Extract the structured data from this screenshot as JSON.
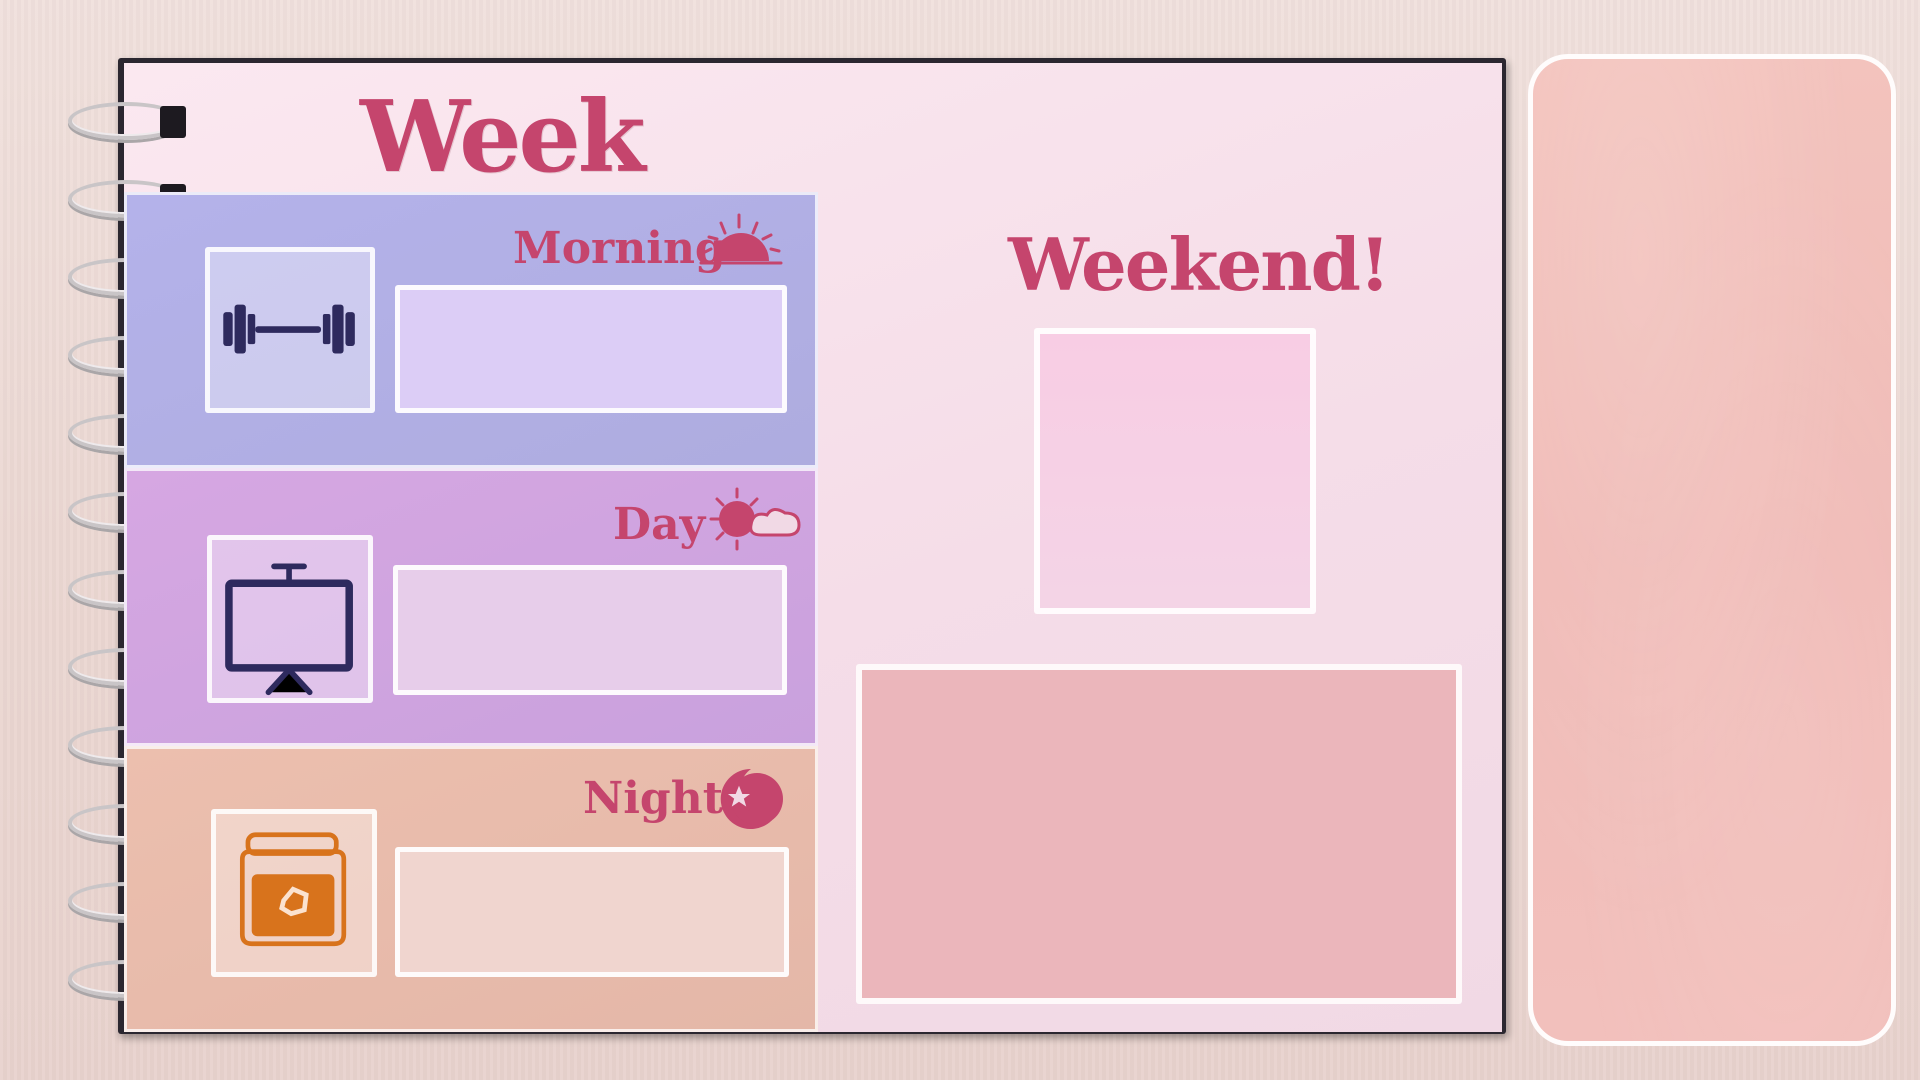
{
  "planner": {
    "week_title": "Week",
    "weekend_title": "Weekend!",
    "sections": [
      {
        "label": "Morning",
        "activity_icon": "dumbbell-icon",
        "time_icon": "sunrise-icon"
      },
      {
        "label": "Day",
        "activity_icon": "tv-icon",
        "time_icon": "sun-cloud-icon"
      },
      {
        "label": "Night",
        "activity_icon": "jar-icon",
        "time_icon": "moon-star-icon"
      }
    ]
  },
  "colors": {
    "title": "#c5456d",
    "icon_dark": "#2e2a5e",
    "icon_orange": "#d8731c",
    "morning_band": "#b4b2ea",
    "day_band": "#d6a7e2",
    "night_band": "#ecbfae",
    "weekend_panel": "#ebb6bb",
    "side_panel": "#f3c3bd"
  }
}
